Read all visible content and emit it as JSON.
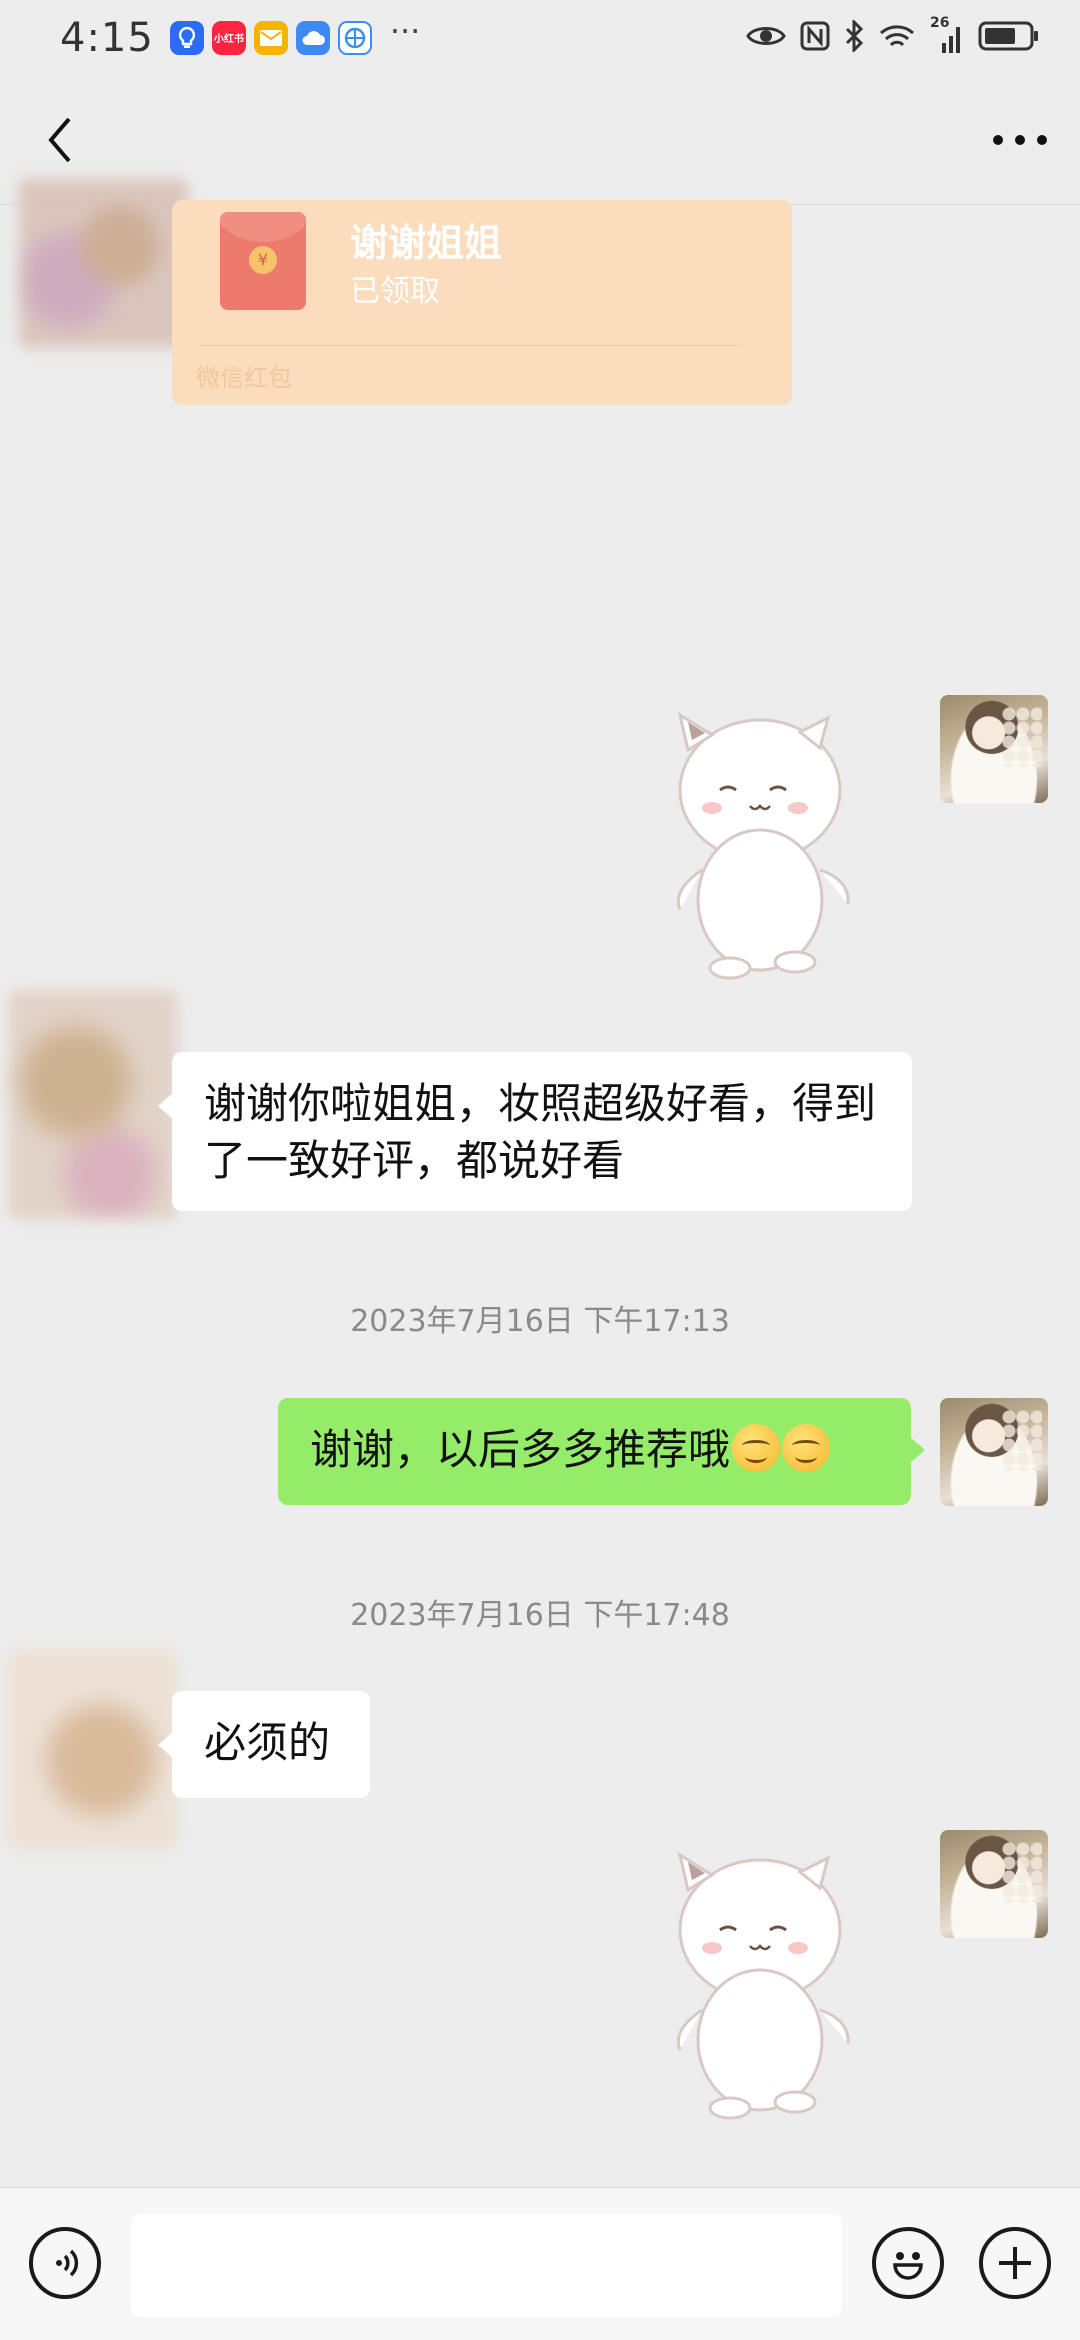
{
  "status_bar": {
    "time": "4:15",
    "more": "···",
    "network": "26",
    "app_icons": [
      {
        "name": "bulb-app-icon",
        "color": "#2a6df4",
        "label": ""
      },
      {
        "name": "xiaohongshu-app-icon",
        "color": "#ff2442",
        "label": "小红书"
      },
      {
        "name": "mail-app-icon",
        "color": "#f6b400",
        "label": ""
      },
      {
        "name": "cloud-app-icon",
        "color": "#3d8af7",
        "label": ""
      },
      {
        "name": "browser-app-icon",
        "color": "#3b8ef0",
        "label": ""
      }
    ]
  },
  "red_packet": {
    "title": "谢谢姐姐",
    "status": "已领取",
    "footer": "微信红包",
    "coin": "¥"
  },
  "messages": {
    "msg1": "谢谢你啦姐姐，妆照超级好看，得到了一致好评，都说好看",
    "ts1": "2023年7月16日 下午17:13",
    "msg2": "谢谢，以后多多推荐哦",
    "ts2": "2023年7月16日 下午17:48",
    "msg3": "必须的"
  },
  "input": {
    "placeholder": ""
  },
  "colors": {
    "background": "#ededed",
    "outgoing_bubble": "#95ec69",
    "incoming_bubble": "#ffffff",
    "red_packet": "#fbdcbc"
  }
}
